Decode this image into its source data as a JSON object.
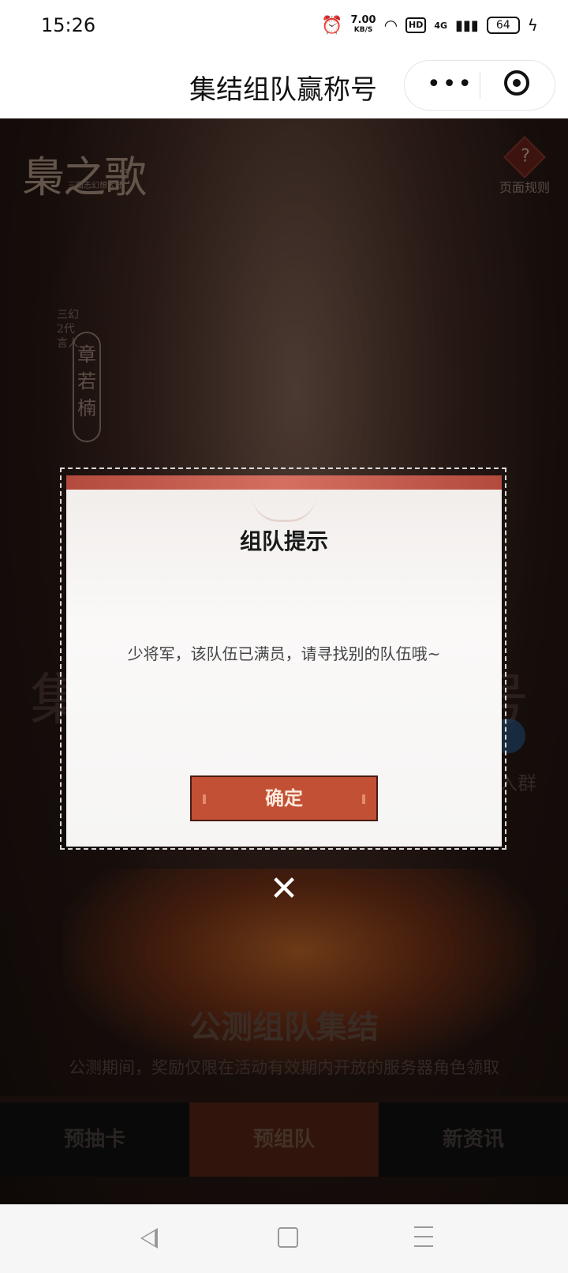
{
  "status_bar": {
    "time": "15:26",
    "net_speed_value": "7.00",
    "net_speed_unit": "KB/S",
    "network": "4G",
    "hd": "HD",
    "battery": "64"
  },
  "title_bar": {
    "title": "集结组队赢称号",
    "more_icon": "more-dots-icon",
    "close_icon": "target-icon"
  },
  "page": {
    "logo": "梟之歌",
    "logo_sub": "三国志幻想大陆",
    "logo_num": "2",
    "rules_icon": "?",
    "rules_label": "页面规则",
    "spokesperson_label": "三幻2代言人",
    "spokesperson_name": "章若楠",
    "side_left": "集",
    "side_right": "号",
    "join_label": "入群",
    "section_title": "公测组队集结",
    "section_desc": "公测期间，奖励仅限在活动有效期内开放的服务器角色领取"
  },
  "tabs": [
    {
      "label": "预抽卡",
      "active": false
    },
    {
      "label": "预组队",
      "active": true
    },
    {
      "label": "新资讯",
      "active": false
    }
  ],
  "modal": {
    "title": "组队提示",
    "message": "少将军，该队伍已满员，请寻找别的队伍哦~",
    "confirm_label": "确定",
    "close_icon": "close-icon"
  },
  "colors": {
    "accent": "#c25034",
    "tab_active": "#5a2515"
  }
}
